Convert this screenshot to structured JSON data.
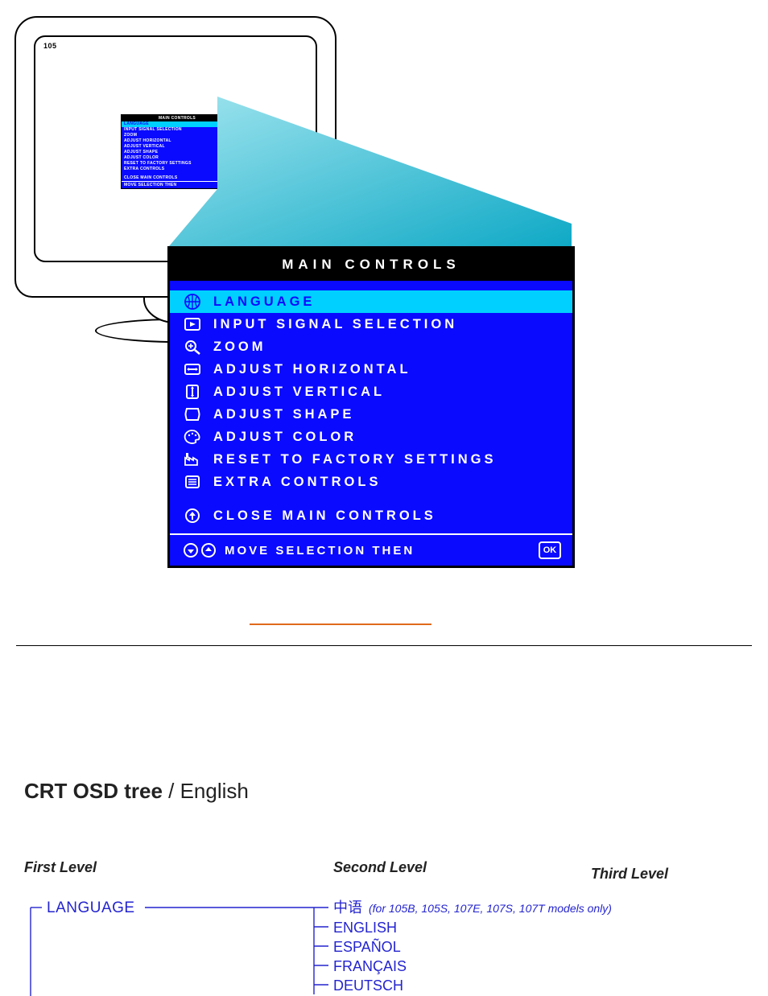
{
  "monitor": {
    "badge": "105"
  },
  "osd": {
    "title": "MAIN CONTROLS",
    "items": [
      {
        "icon": "globe-icon",
        "label": "LANGUAGE",
        "selected": true
      },
      {
        "icon": "input-icon",
        "label": "INPUT SIGNAL SELECTION",
        "selected": false
      },
      {
        "icon": "magnifier-icon",
        "label": "ZOOM",
        "selected": false
      },
      {
        "icon": "horiz-icon",
        "label": "ADJUST HORIZONTAL",
        "selected": false
      },
      {
        "icon": "vert-icon",
        "label": "ADJUST VERTICAL",
        "selected": false
      },
      {
        "icon": "shape-icon",
        "label": "ADJUST SHAPE",
        "selected": false
      },
      {
        "icon": "palette-icon",
        "label": "ADJUST COLOR",
        "selected": false
      },
      {
        "icon": "factory-icon",
        "label": "RESET TO FACTORY SETTINGS",
        "selected": false
      },
      {
        "icon": "extra-icon",
        "label": "EXTRA CONTROLS",
        "selected": false
      }
    ],
    "close": {
      "icon": "close-circle-icon",
      "label": "CLOSE MAIN CONTROLS"
    },
    "footer": {
      "text": "MOVE SELECTION THEN",
      "ok": "OK"
    }
  },
  "tree": {
    "heading_bold": "CRT OSD tree",
    "heading_rest": " / English",
    "columns": {
      "first": "First Level",
      "second": "Second Level",
      "third": "Third Level"
    },
    "level1_first": "LANGUAGE",
    "languages": [
      {
        "label": "中语",
        "note": "(for 105B, 105S, 107E, 107S, 107T models only)"
      },
      {
        "label": "ENGLISH"
      },
      {
        "label": "ESPAÑOL"
      },
      {
        "label": "FRANÇAIS"
      },
      {
        "label": "DEUTSCH"
      }
    ]
  }
}
